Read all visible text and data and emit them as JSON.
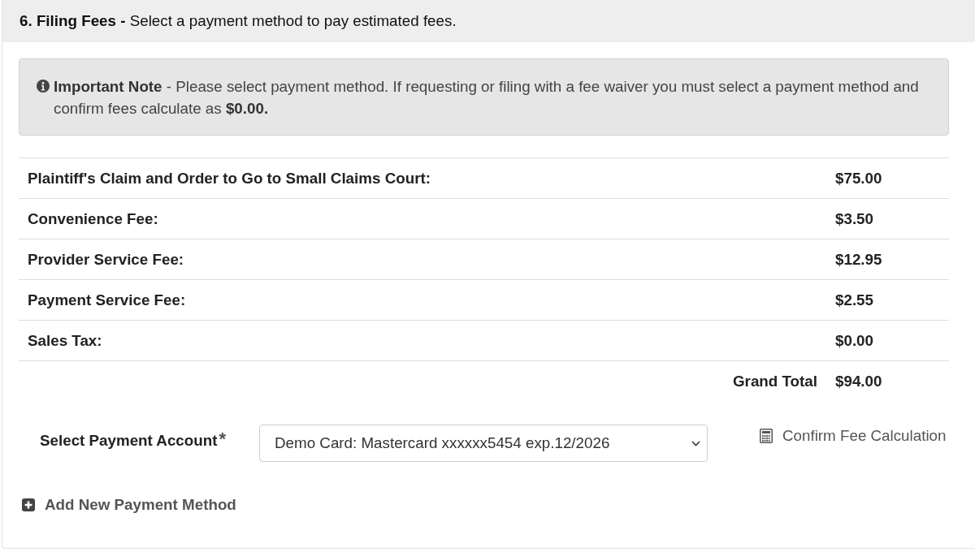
{
  "section": {
    "title": "**6. Filing Fees -** Select a payment method to pay estimated fees."
  },
  "note": {
    "text": "**Important Note** - Please select payment method. If requesting or filing with a fee waiver you must select a payment method and confirm fees calculate as **$0.00.**"
  },
  "fees": {
    "rows": [
      {
        "label": "Plaintiff's Claim and Order to Go to Small Claims Court:",
        "amount": "$75.00"
      },
      {
        "label": "Convenience Fee:",
        "amount": "$3.50"
      },
      {
        "label": "Provider Service Fee:",
        "amount": "$12.95"
      },
      {
        "label": "Payment Service Fee:",
        "amount": "$2.55"
      },
      {
        "label": "Sales Tax:",
        "amount": "$0.00"
      }
    ],
    "total": {
      "label": "Grand Total",
      "amount": "$94.00"
    }
  },
  "payment": {
    "label": "Select Payment Account",
    "required_mark": "*",
    "account": "Demo Card: Mastercard xxxxxx5454 exp.12/2026",
    "confirm_link": "Confirm Fee Calculation"
  },
  "add_method": {
    "label": "Add New Payment Method"
  }
}
